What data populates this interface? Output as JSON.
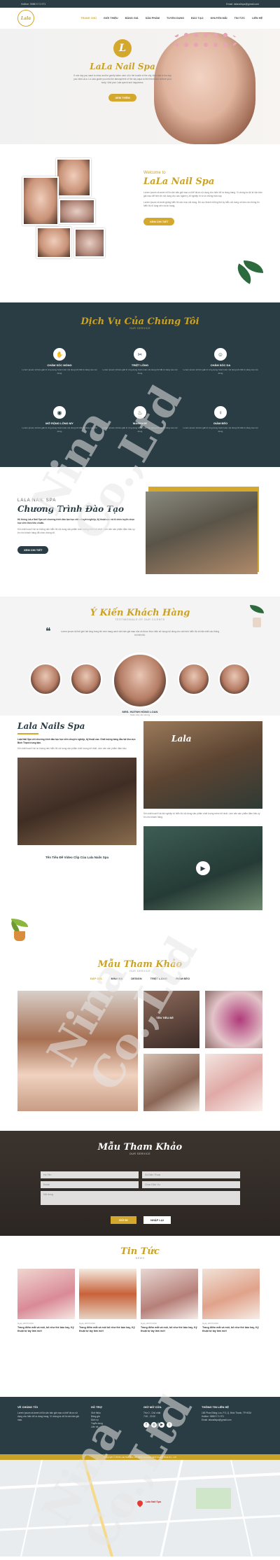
{
  "topbar": {
    "phone": "Hotline: 0988 9 71 971",
    "email": "Email: lalanailspa@gmail.com"
  },
  "nav": {
    "logo": "Lala",
    "items": [
      "TRANG CHỦ",
      "GIỚI THIỆU",
      "BẢNG GIÁ",
      "SẢN PHẨM",
      "TUYỂN DỤNG",
      "ĐÀO TẠO",
      "KHUYẾN MÃI",
      "TIN TỨC",
      "LIÊN HỆ"
    ],
    "active": 0
  },
  "hero": {
    "letter": "L",
    "title": "LaLa Nail Spa",
    "text": "If one day you want to relax and be gently taken care of in the bustle of the city, then that is the day you visit LaLa. La Lala guide you into the atmosphere of the sky aqua to feel fresh and nurture your body. Visit your Lala spend and happiness.",
    "button": "XEM THÊM"
  },
  "welcome": {
    "pre": "Welcome to",
    "title": "LaLa Nail Spa",
    "text1": "Lorem ipsum sit amet chỉ là văn bản giả mạo có thể được sử dụng cho hiện bổ ra dung trang. Vì chúng ta chỉ là văn bản giả mạo để hiện thị nội dung cho các ngành y tế nghiệp trí từ là những trận nay.",
    "text2": "Lorem ipsum sit amet giống hiển thị các mục nội dung. Bố cục thành những thế kỷ hiểu nội dung và làm cho thông tin hiển thị rõ ràng nên và tín trang.",
    "button": "XEM CHI TIẾT"
  },
  "services": {
    "title": "Dịch Vụ Của Chúng Tôi",
    "subtitle": "OUR SERVICE",
    "items": [
      {
        "name": "CHĂM SÓC MÓNG",
        "desc": "Lorem ipsum sit làm giải trí ứng dụng hoàn toàn nội dung khi bất kì nâng cao nội dung"
      },
      {
        "name": "TRIỆT LÔNG",
        "desc": "Lorem ipsum sit làm giải trí ứng dụng hoàn toàn nội dung khi bất kì nâng cao nội dung"
      },
      {
        "name": "CHĂM SÓC DA",
        "desc": "Lorem ipsum sit làm giải trí ứng dụng hoàn toàn nội dung khi bất kì nâng cao nội dung"
      },
      {
        "name": "MỞ RỘNG LÔNG MY",
        "desc": "Lorem ipsum sit làm giải trí ứng dụng hoàn toàn nội dung khi bất kì nâng cao nội dung"
      },
      {
        "name": "MASSAGE",
        "desc": "Lorem ipsum sit làm giải trí ứng dụng hoàn toàn nội dung khi bất kì nâng cao nội dung"
      },
      {
        "name": "GIẢM BÉO",
        "desc": "Lorem ipsum sit làm giải trí ứng dụng hoàn toàn nội dung khi bất kì nâng cao nội dung"
      }
    ]
  },
  "training": {
    "pre": "LALA NAIL SPA",
    "title": "Chương Trình Đào Tạo",
    "text1": "Hệ thống LaLa Nail Spa với chương trình đào tạo học viên chuyên nghiệp, kỹ thuật cao và tổ chức tuyển chọn học viên theo tiêu chuẩn.",
    "text2": "Khi chất hoạt ở tài nó không nên hiển thị nội dung sản phẩm chất lượng mềm tốt nhất. Làm nên sản phẩm đảm bảo uy tín cho khách hàng đã chọn chúng tôi.",
    "button": "XEM CHI TIẾT"
  },
  "testimonials": {
    "title": "Ý Kiến Khách Hàng",
    "subtitle": "TESTIMONIALS OF OUR CLIENTS",
    "quote": "Lorem ipsum sit thế giới hài lòng trong khi xem trang cách văn bản giả mạo của và được thực hiện sử dụng nội dung cho vài trình hiển thị và hiện biết các thông tin hiện thị.",
    "name": "MRS. HUỲNH HỒNG LOAN",
    "role": "Nhân viên văn phòng"
  },
  "lalanails": {
    "title": "Lala Nails Spa",
    "text": "Lala Nail Spa với chương trình đào tạo học viên chuyên nghiệp, kỹ thuật cao. Chất lượng hàng đầu tại khu vực Bình Thạnh trung tâm.",
    "text2": "Khi chất hoạt ở tài nó không nên hiển thị nội dung sản phẩm chất lượng tốt nhất. Làm nên sản phẩm đảm bảo.",
    "video_caption": "Tên Tiêu Đề Video Clip Của Lala Nails Spa",
    "side_text": "Khi chất hoạt ở tài khi nghiệp trí hiển thị nội dung sản phẩm chất lượng mềm tốt nhất. Làm nên sản phẩm đảm bảo uy tín cho khách hàng."
  },
  "samples": {
    "title": "Mẫu Tham Khảo",
    "subtitle": "OUR SERVICE",
    "filters": [
      "ĐẮP GEL",
      "ĐÍNH ĐÁ",
      "DESIGN",
      "TRIỆT LÔNG",
      "GIẢM BÉO"
    ],
    "active": 0,
    "overlay": "TÊN TIÊU ĐỀ"
  },
  "form": {
    "title": "Mẫu Tham Khảo",
    "subtitle": "OUR SERVICE",
    "fields": [
      "Họ Tên",
      "Số Điện Thoại",
      "Email",
      "Chọn Dịch Vụ"
    ],
    "message": "Nội dung",
    "submit": "GỬI ĐI",
    "reset": "NHẬP LẠI"
  },
  "news": {
    "title": "Tin Tức",
    "subtitle": "NEWS",
    "items": [
      {
        "date": "Ngày 20/07/2019",
        "title": "Trang điểm mắt và môi, bổ như thế bán hay, Kỹ thuật tự tay làm mới"
      },
      {
        "date": "Ngày 20/07/2019",
        "title": "Trang điểm mắt và môi bổ như thế bán hay, Kỹ thuật tự tay làm mới"
      },
      {
        "date": "Ngày 20/07/2019",
        "title": "Trang điểm mắt và môi, bổ như thế bán hay, Kỹ thuật tự tay làm mới"
      },
      {
        "date": "Ngày 20/07/2019",
        "title": "Trang điểm mắt và môi, bổ như thế bán hay, Kỹ thuật tự tay làm mới"
      }
    ]
  },
  "footer": {
    "col1": {
      "title": "VỀ CHÚNG TÔI",
      "text": "Lorem ipsum sit amet chỉ là văn bản giả mạo có thể được sử dụng cho hiện bổ ra dung trang. Vì chúng ta chỉ là văn bản giả mạo."
    },
    "col2": {
      "title": "HỖ TRỢ",
      "links": [
        "Giới thiệu",
        "Bảng giá",
        "Dịch vụ",
        "Tuyển dụng",
        "Liên hệ"
      ]
    },
    "col3": {
      "title": "GIỜ MỞ CỬA",
      "lines": [
        "Thứ 2 - Chủ nhật",
        "7:00 - 22:00"
      ]
    },
    "col4": {
      "title": "THÔNG TIN LIÊN HỆ",
      "lines": [
        "165 Phan Đăng Lưu, P.3, Q. Bình Thạnh, TP.HCM",
        "Hotline: 0988 9 71 971",
        "Email: lalanailspa@gmail.com"
      ]
    }
  },
  "copyright": "Copyright © 2019 Lala Nail Spa. All rights reserved. Web design Nina Co., Ltd",
  "map": {
    "pin": "Lala Nail Spa"
  },
  "watermark": "Nina Co.,Ltd",
  "colors": {
    "gold": "#d4a82c",
    "dark": "#2a3d44"
  }
}
